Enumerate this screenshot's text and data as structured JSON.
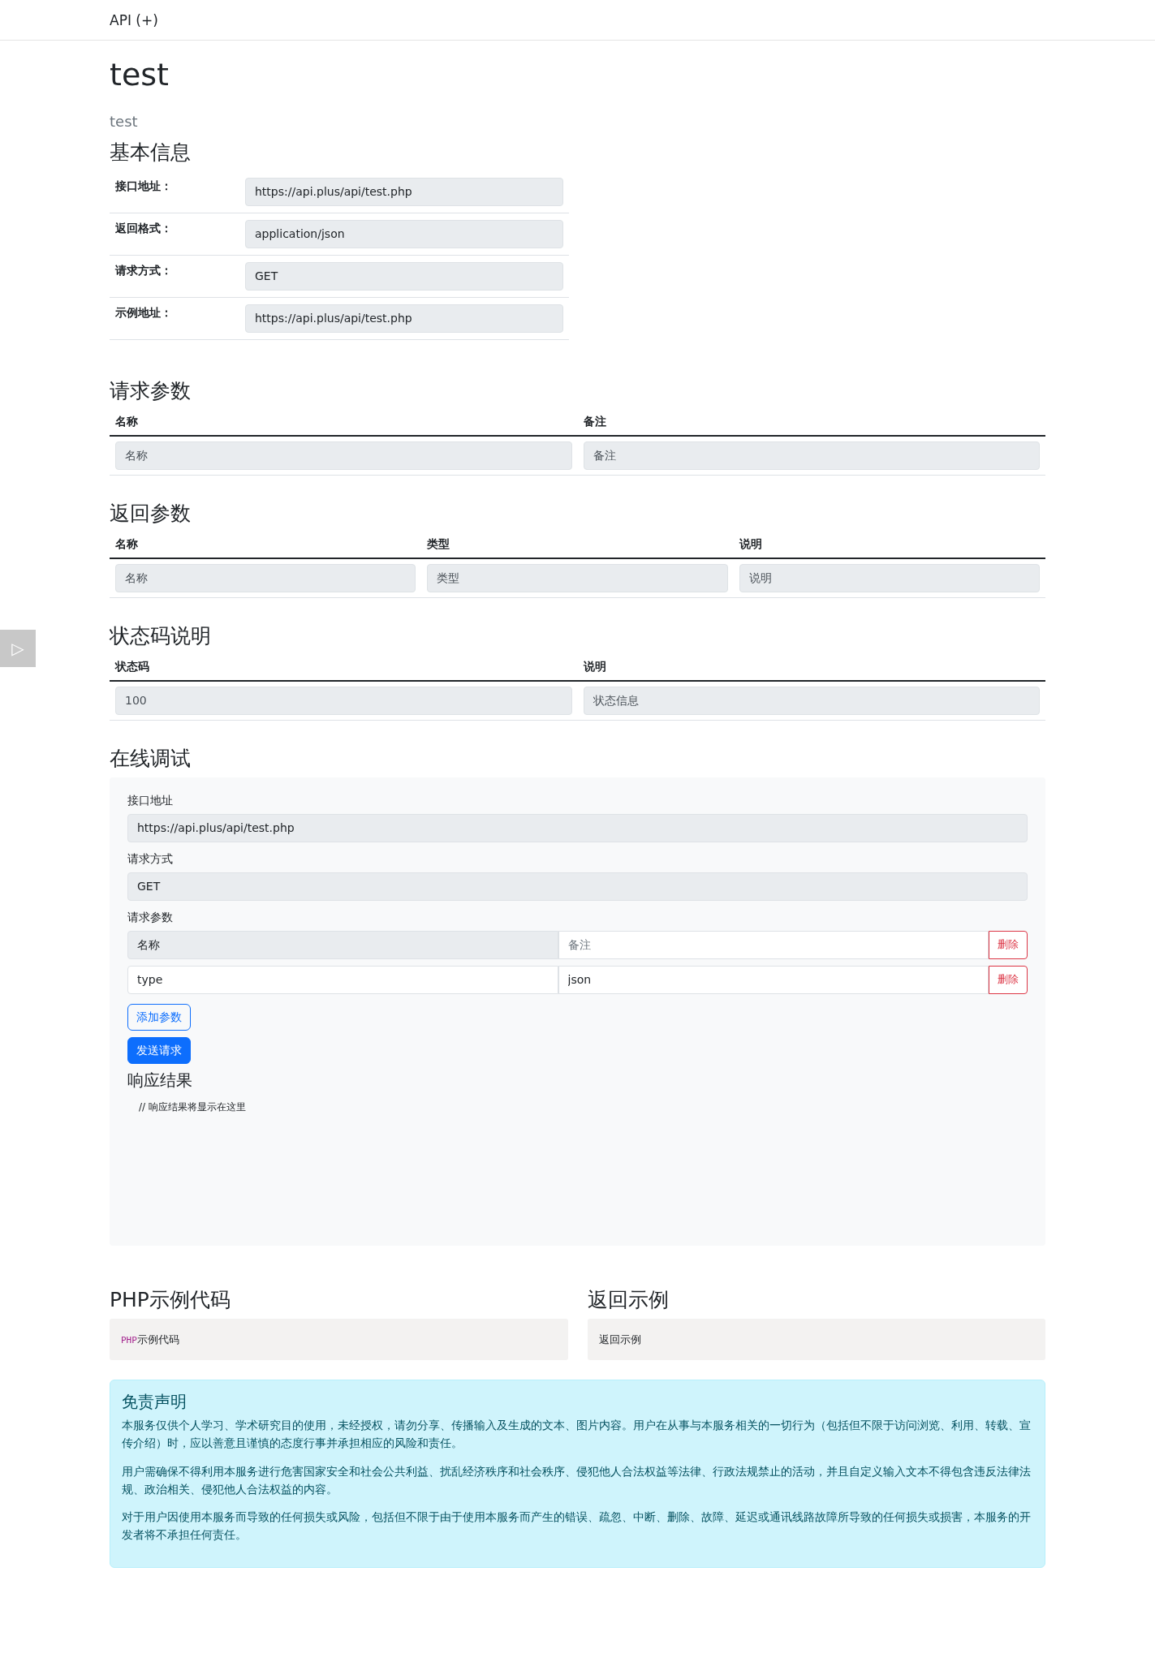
{
  "navbar": {
    "brand": "API (+)"
  },
  "title": "test",
  "description": "test",
  "side_button": {
    "label": "▷"
  },
  "basic_info": {
    "heading": "基本信息",
    "rows": [
      {
        "label": "接口地址：",
        "value": "https://api.plus/api/test.php"
      },
      {
        "label": "返回格式：",
        "value": "application/json"
      },
      {
        "label": "请求方式：",
        "value": "GET"
      },
      {
        "label": "示例地址：",
        "value": "https://api.plus/api/test.php"
      }
    ]
  },
  "tables": [
    {
      "heading": "请求参数",
      "columns": [
        "名称",
        "备注"
      ],
      "rows": [
        [
          "名称",
          "备注"
        ]
      ]
    },
    {
      "heading": "返回参数",
      "columns": [
        "名称",
        "类型",
        "说明"
      ],
      "rows": [
        [
          "名称",
          "类型",
          "说明"
        ]
      ]
    },
    {
      "heading": "状态码说明",
      "columns": [
        "状态码",
        "说明"
      ],
      "rows": [
        [
          "100",
          "状态信息"
        ]
      ]
    }
  ],
  "debug": {
    "heading": "在线调试",
    "fields": [
      {
        "label": "接口地址",
        "value": "https://api.plus/api/test.php"
      },
      {
        "label": "请求方式",
        "value": "GET"
      }
    ],
    "params_label": "请求参数",
    "params": [
      {
        "cells": [
          {
            "value": "名称",
            "readonly": true
          },
          {
            "placeholder": "备注",
            "readonly": false
          }
        ],
        "delete": "删除"
      },
      {
        "cells": [
          {
            "value": "type",
            "readonly": false
          },
          {
            "value": "json",
            "readonly": false
          }
        ],
        "delete": "删除"
      }
    ],
    "add_button": "添加参数",
    "send_button": "发送请求",
    "response_heading": "响应结果",
    "response_text": "// 响应结果将显示在这里"
  },
  "examples": [
    {
      "heading": "PHP示例代码",
      "code": [
        {
          "text": "PHP",
          "kind": "keyword"
        },
        {
          "text": "示例代码",
          "kind": "plain"
        }
      ]
    },
    {
      "heading": "返回示例",
      "code": [
        {
          "text": "返回示例",
          "kind": "plain"
        }
      ]
    }
  ],
  "disclaimer": {
    "heading": "免责声明",
    "paragraphs": [
      "本服务仅供个人学习、学术研究目的使用，未经授权，请勿分享、传播输入及生成的文本、图片内容。用户在从事与本服务相关的一切行为（包括但不限于访问浏览、利用、转载、宣传介绍）时，应以善意且谨慎的态度行事并承担相应的风险和责任。",
      "用户需确保不得利用本服务进行危害国家安全和社会公共利益、扰乱经济秩序和社会秩序、侵犯他人合法权益等法律、行政法规禁止的活动，并且自定义输入文本不得包含违反法律法规、政治相关、侵犯他人合法权益的内容。",
      "对于用户因使用本服务而导致的任何损失或风险，包括但不限于由于使用本服务而产生的错误、疏忽、中断、删除、故障、延迟或通讯线路故障所导致的任何损失或损害，本服务的开发者将不承担任何责任。"
    ]
  }
}
